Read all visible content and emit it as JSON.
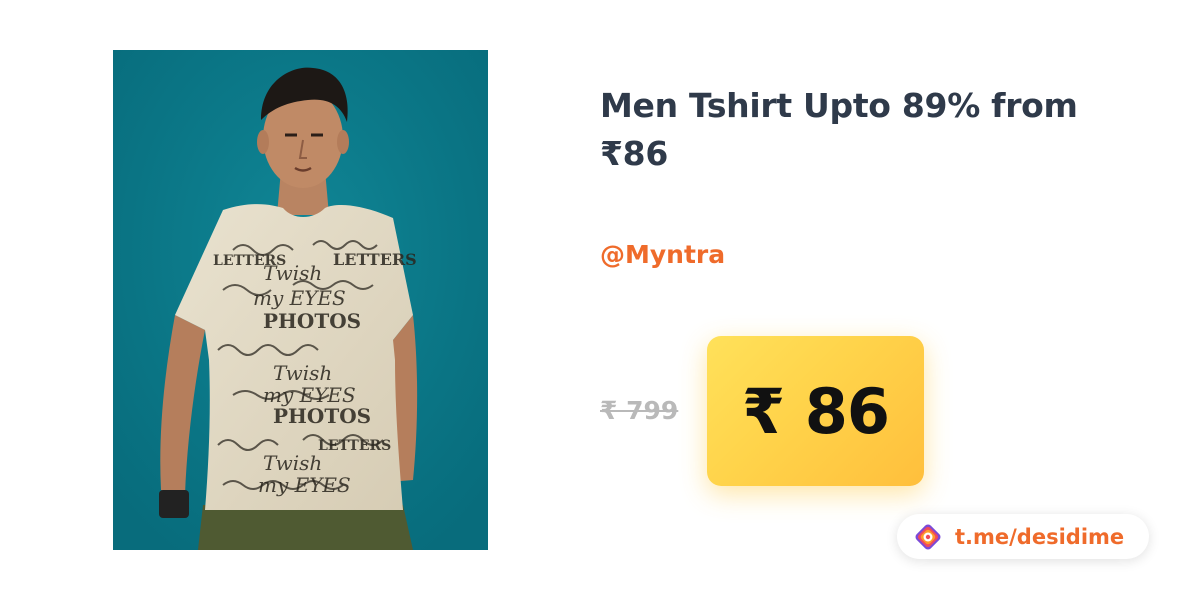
{
  "deal": {
    "title": "Men Tshirt Upto 89% from ₹86",
    "store": "@Myntra",
    "original_price": "₹ 799",
    "deal_price": "₹ 86"
  },
  "channel": {
    "label": "t.me/desidime",
    "icon": "desidime-logo-icon"
  },
  "product_image": {
    "icon": "tshirt-model-photo",
    "background_color": "#0a7686",
    "shirt_print_words": [
      "Twish",
      "my EYES",
      "PHOTOS",
      "LETTERS"
    ]
  },
  "colors": {
    "title": "#2f3a4a",
    "store": "#ef6b2b",
    "badge": "#ffd34a",
    "strike_price": "#b9b9b9"
  }
}
